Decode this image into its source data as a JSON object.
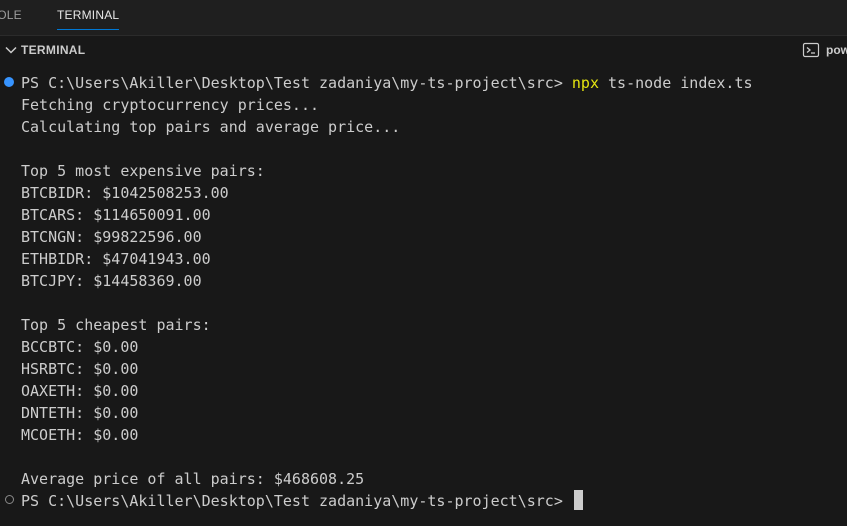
{
  "tabs": [
    {
      "label": "SOLE",
      "active": false
    },
    {
      "label": "TERMINAL",
      "active": true
    }
  ],
  "panel": {
    "title": "TERMINAL",
    "shell_label": "pow"
  },
  "terminal": {
    "prompt": "PS C:\\Users\\Akiller\\Desktop\\Test zadaniya\\my-ts-project\\src> ",
    "command_bin": "npx",
    "command_args": " ts-node index.ts",
    "output": [
      "Fetching cryptocurrency prices...",
      "Calculating top pairs and average price...",
      "",
      "Top 5 most expensive pairs:",
      "BTCBIDR: $1042508253.00",
      "BTCARS: $114650091.00",
      "BTCNGN: $99822596.00",
      "ETHBIDR: $47041943.00",
      "BTCJPY: $14458369.00",
      "",
      "Top 5 cheapest pairs:",
      "BCCBTC: $0.00",
      "HSRBTC: $0.00",
      "OAXETH: $0.00",
      "DNTETH: $0.00",
      "MCOETH: $0.00",
      "",
      "Average price of all pairs: $468608.25"
    ],
    "final_prompt": "PS C:\\Users\\Akiller\\Desktop\\Test zadaniya\\my-ts-project\\src>",
    "colors": {
      "background": "#181818",
      "text": "#cccccc",
      "command_highlight": "#e5e510",
      "success_dot": "#3794ff",
      "tab_underline": "#0078d4"
    }
  }
}
